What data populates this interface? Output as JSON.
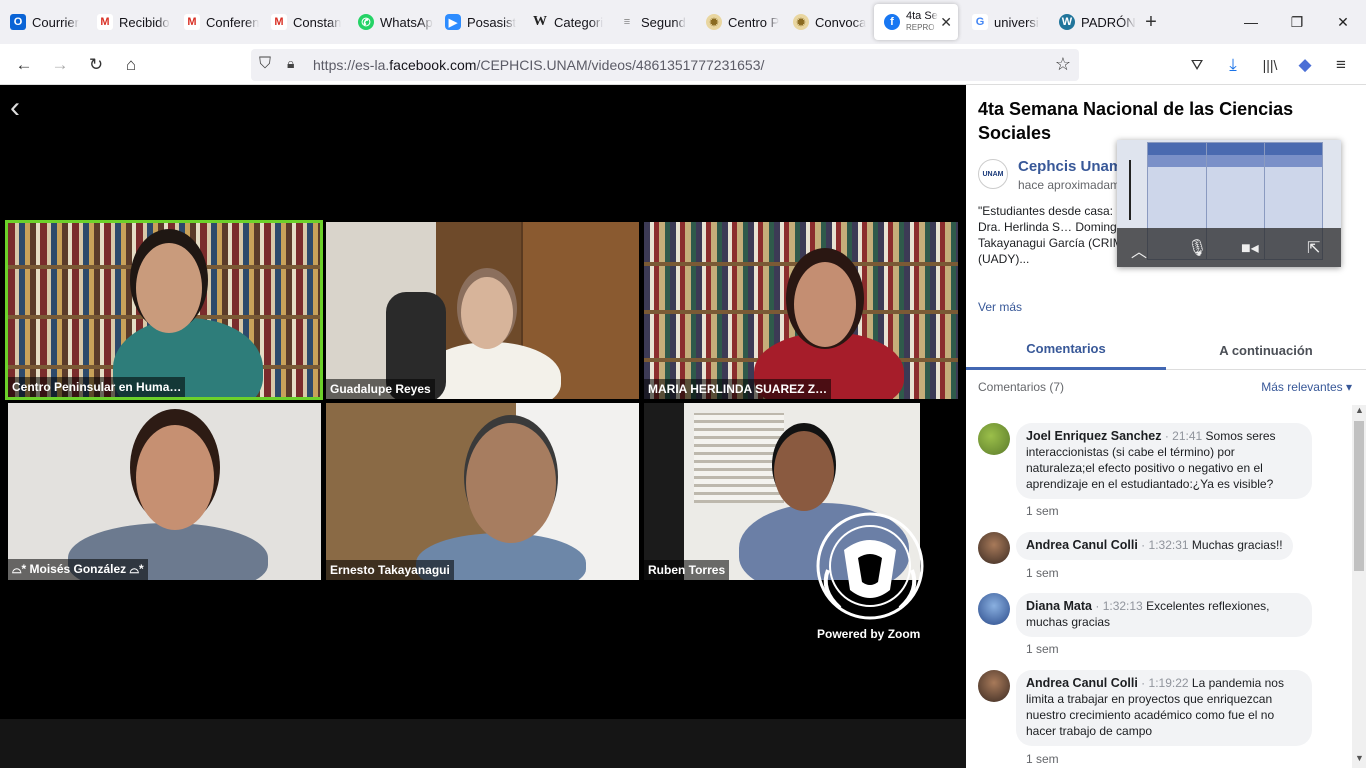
{
  "browser": {
    "tabs": [
      {
        "title": "Courrier",
        "icon": "outlook-icon",
        "color": "#0a64d6"
      },
      {
        "title": "Recibido",
        "icon": "gmail-icon",
        "color": "#d93025"
      },
      {
        "title": "Conferen",
        "icon": "gmail-icon",
        "color": "#d93025"
      },
      {
        "title": "Constan",
        "icon": "gmail-icon",
        "color": "#d93025"
      },
      {
        "title": "WhatsAp",
        "icon": "whatsapp-icon",
        "color": "#25d366"
      },
      {
        "title": "Posasist",
        "icon": "zoom-icon",
        "color": "#2d8cff"
      },
      {
        "title": "Categori",
        "icon": "wikipedia-icon",
        "color": "#333333"
      },
      {
        "title": "Segund",
        "icon": "document-icon",
        "color": "#888888"
      },
      {
        "title": "Centro P",
        "icon": "seal-icon",
        "color": "#c8a24a"
      },
      {
        "title": "Convoca",
        "icon": "seal-icon",
        "color": "#c8a24a"
      }
    ],
    "active_tab": {
      "title": "4ta Se",
      "subtitle": "REPRO",
      "icon": "facebook-icon",
      "color": "#1877f2"
    },
    "tabs_after": [
      {
        "title": "universi",
        "icon": "google-icon",
        "color": "#4285f4"
      },
      {
        "title": "PADRÓN",
        "icon": "wordpress-icon",
        "color": "#21759b"
      }
    ],
    "new_tab": "+",
    "url_prefix": "https://es-la.",
    "url_domain": "facebook.com",
    "url_path": "/CEPHCIS.UNAM/videos/4861351777231653/"
  },
  "video": {
    "back": "‹",
    "participants": [
      "Centro Peninsular en Huma…",
      "Guadalupe Reyes",
      "MARIA HERLINDA SUAREZ Z…",
      "⌓* Moisés González ⌓*",
      "Ernesto Takayanagui",
      "Ruben Torres"
    ],
    "powered_by": "Powered by Zoom"
  },
  "panel": {
    "title": "4ta Semana Nacional de las Ciencias Sociales",
    "page_name": "Cephcis Unam",
    "page_logo": "UNAM",
    "post_time": "hace aproximadam",
    "description": "\"Estudiantes desde casa: … estudiantil en educación s… Ponentes: Dra. Herlinda S… Dominguez (UADY)/ Dr. R… Mtro. Ernesto Takayanagui García (CRIM-UNAM)/ Lic. Moisés González Mata (UADY)...",
    "see_more": "Ver más",
    "tab_comments": "Comentarios",
    "tab_next": "A continuación",
    "comment_count": "Comentarios (7)",
    "sort_label": "Más relevantes ▾",
    "comments": [
      {
        "author": "Joel Enriquez Sanchez",
        "time": "21:41",
        "text": "Somos seres interaccionistas (si cabe el término) por naturaleza;el efecto positivo o negativo en el aprendizaje en el estudiantado:¿Ya es visible?",
        "ago": "1 sem"
      },
      {
        "author": "Andrea Canul Colli",
        "time": "1:32:31",
        "text": "Muchas gracias!!",
        "ago": "1 sem"
      },
      {
        "author": "Diana Mata",
        "time": "1:32:13",
        "text": "Excelentes reflexiones, muchas gracias",
        "ago": "1 sem"
      },
      {
        "author": "Andrea Canul Colli",
        "time": "1:19:22",
        "text": "La pandemia nos limita a trabajar en proyectos que enriquezcan nuestro crecimiento académico como fue el no hacer trabajo de campo",
        "ago": "1 sem"
      }
    ]
  }
}
